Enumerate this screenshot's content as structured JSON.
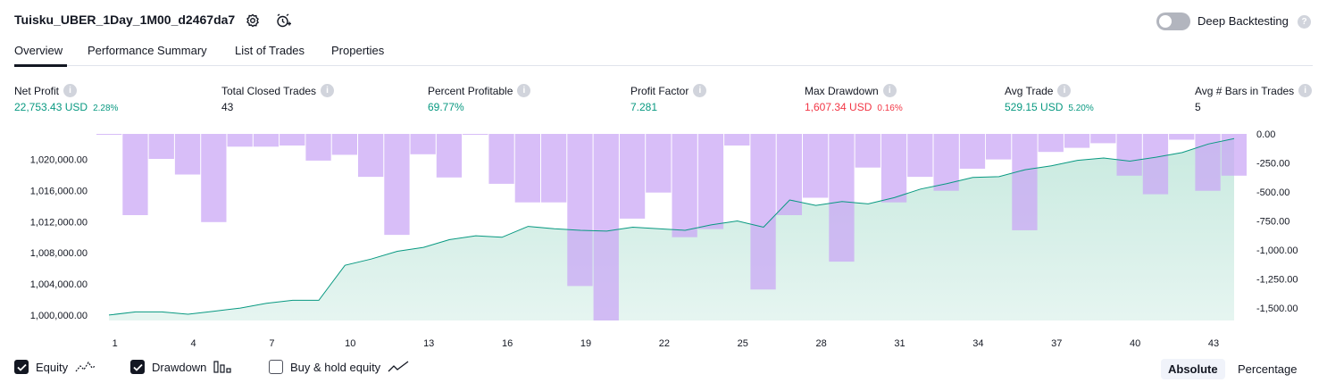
{
  "header": {
    "title": "Tuisku_UBER_1Day_1M00_d2467da7",
    "deep_backtesting_label": "Deep Backtesting",
    "deep_backtesting_on": false
  },
  "tabs": [
    "Overview",
    "Performance Summary",
    "List of Trades",
    "Properties"
  ],
  "active_tab": "Overview",
  "metrics": [
    {
      "label": "Net Profit",
      "value": "22,753.43 USD",
      "pct": "2.28%",
      "color": "#089981"
    },
    {
      "label": "Total Closed Trades",
      "value": "43",
      "pct": "",
      "color": "#131722"
    },
    {
      "label": "Percent Profitable",
      "value": "69.77%",
      "pct": "",
      "color": "#089981"
    },
    {
      "label": "Profit Factor",
      "value": "7.281",
      "pct": "",
      "color": "#089981"
    },
    {
      "label": "Max Drawdown",
      "value": "1,607.34 USD",
      "pct": "0.16%",
      "color": "#f23645"
    },
    {
      "label": "Avg Trade",
      "value": "529.15 USD",
      "pct": "5.20%",
      "color": "#089981"
    },
    {
      "label": "Avg # Bars in Trades",
      "value": "5",
      "pct": "",
      "color": "#131722"
    }
  ],
  "chart_data": {
    "type": "area",
    "x": [
      1,
      2,
      3,
      4,
      5,
      6,
      7,
      8,
      9,
      10,
      11,
      12,
      13,
      14,
      15,
      16,
      17,
      18,
      19,
      20,
      21,
      22,
      23,
      24,
      25,
      26,
      27,
      28,
      29,
      30,
      31,
      32,
      33,
      34,
      35,
      36,
      37,
      38,
      39,
      40,
      41,
      42,
      43,
      44
    ],
    "x_ticks": [
      "1",
      "4",
      "7",
      "10",
      "13",
      "16",
      "19",
      "22",
      "25",
      "28",
      "31",
      "34",
      "37",
      "40",
      "43"
    ],
    "series": [
      {
        "kind": "equity_line",
        "axis": "left",
        "values": [
          1000000,
          1000400,
          1000400,
          1000100,
          1000500,
          1000900,
          1001500,
          1001900,
          1001900,
          1006400,
          1007200,
          1008200,
          1008700,
          1009700,
          1010200,
          1010000,
          1011400,
          1011100,
          1010900,
          1010800,
          1011300,
          1011100,
          1010900,
          1011600,
          1012100,
          1011300,
          1014800,
          1014100,
          1014600,
          1014300,
          1015100,
          1016200,
          1016900,
          1017700,
          1017800,
          1018700,
          1019200,
          1019900,
          1020200,
          1019800,
          1020300,
          1020900,
          1022000,
          1022700
        ],
        "color": "#089981",
        "fill": "#d2eee6"
      },
      {
        "kind": "drawdown_bars",
        "axis": "right",
        "values": [
          -5,
          -700,
          -215,
          -350,
          -760,
          -110,
          -110,
          -100,
          -230,
          -180,
          -370,
          -870,
          -175,
          -375,
          -5,
          -430,
          -590,
          -590,
          -1310,
          -1607,
          -730,
          -505,
          -890,
          -820,
          -100,
          -1340,
          -700,
          -550,
          -1100,
          -290,
          -590,
          -370,
          -490,
          -300,
          -220,
          -830,
          -155,
          -120,
          -80,
          -360,
          -520,
          -50,
          -490,
          -360
        ],
        "color": "#c9a5f5"
      }
    ],
    "y_left_ticks": [
      "1,000,000.00",
      "1,004,000.00",
      "1,008,000.00",
      "1,012,000.00",
      "1,016,000.00",
      "1,020,000.00"
    ],
    "y_left_range": [
      999300,
      1023300
    ],
    "y_right_ticks": [
      "0.00",
      "-250.00",
      "-500.00",
      "-750.00",
      "-1,000.00",
      "-1,250.00",
      "-1,500.00"
    ],
    "y_right_range": [
      -1607,
      0
    ],
    "grid": false
  },
  "legend": [
    {
      "label": "Equity",
      "checked": true,
      "icon": "equity-line-icon"
    },
    {
      "label": "Drawdown",
      "checked": true,
      "icon": "drawdown-bars-icon"
    },
    {
      "label": "Buy & hold equity",
      "checked": false,
      "icon": "buy-hold-line-icon"
    }
  ],
  "view_modes": {
    "absolute": "Absolute",
    "percentage": "Percentage",
    "active": "Absolute"
  }
}
